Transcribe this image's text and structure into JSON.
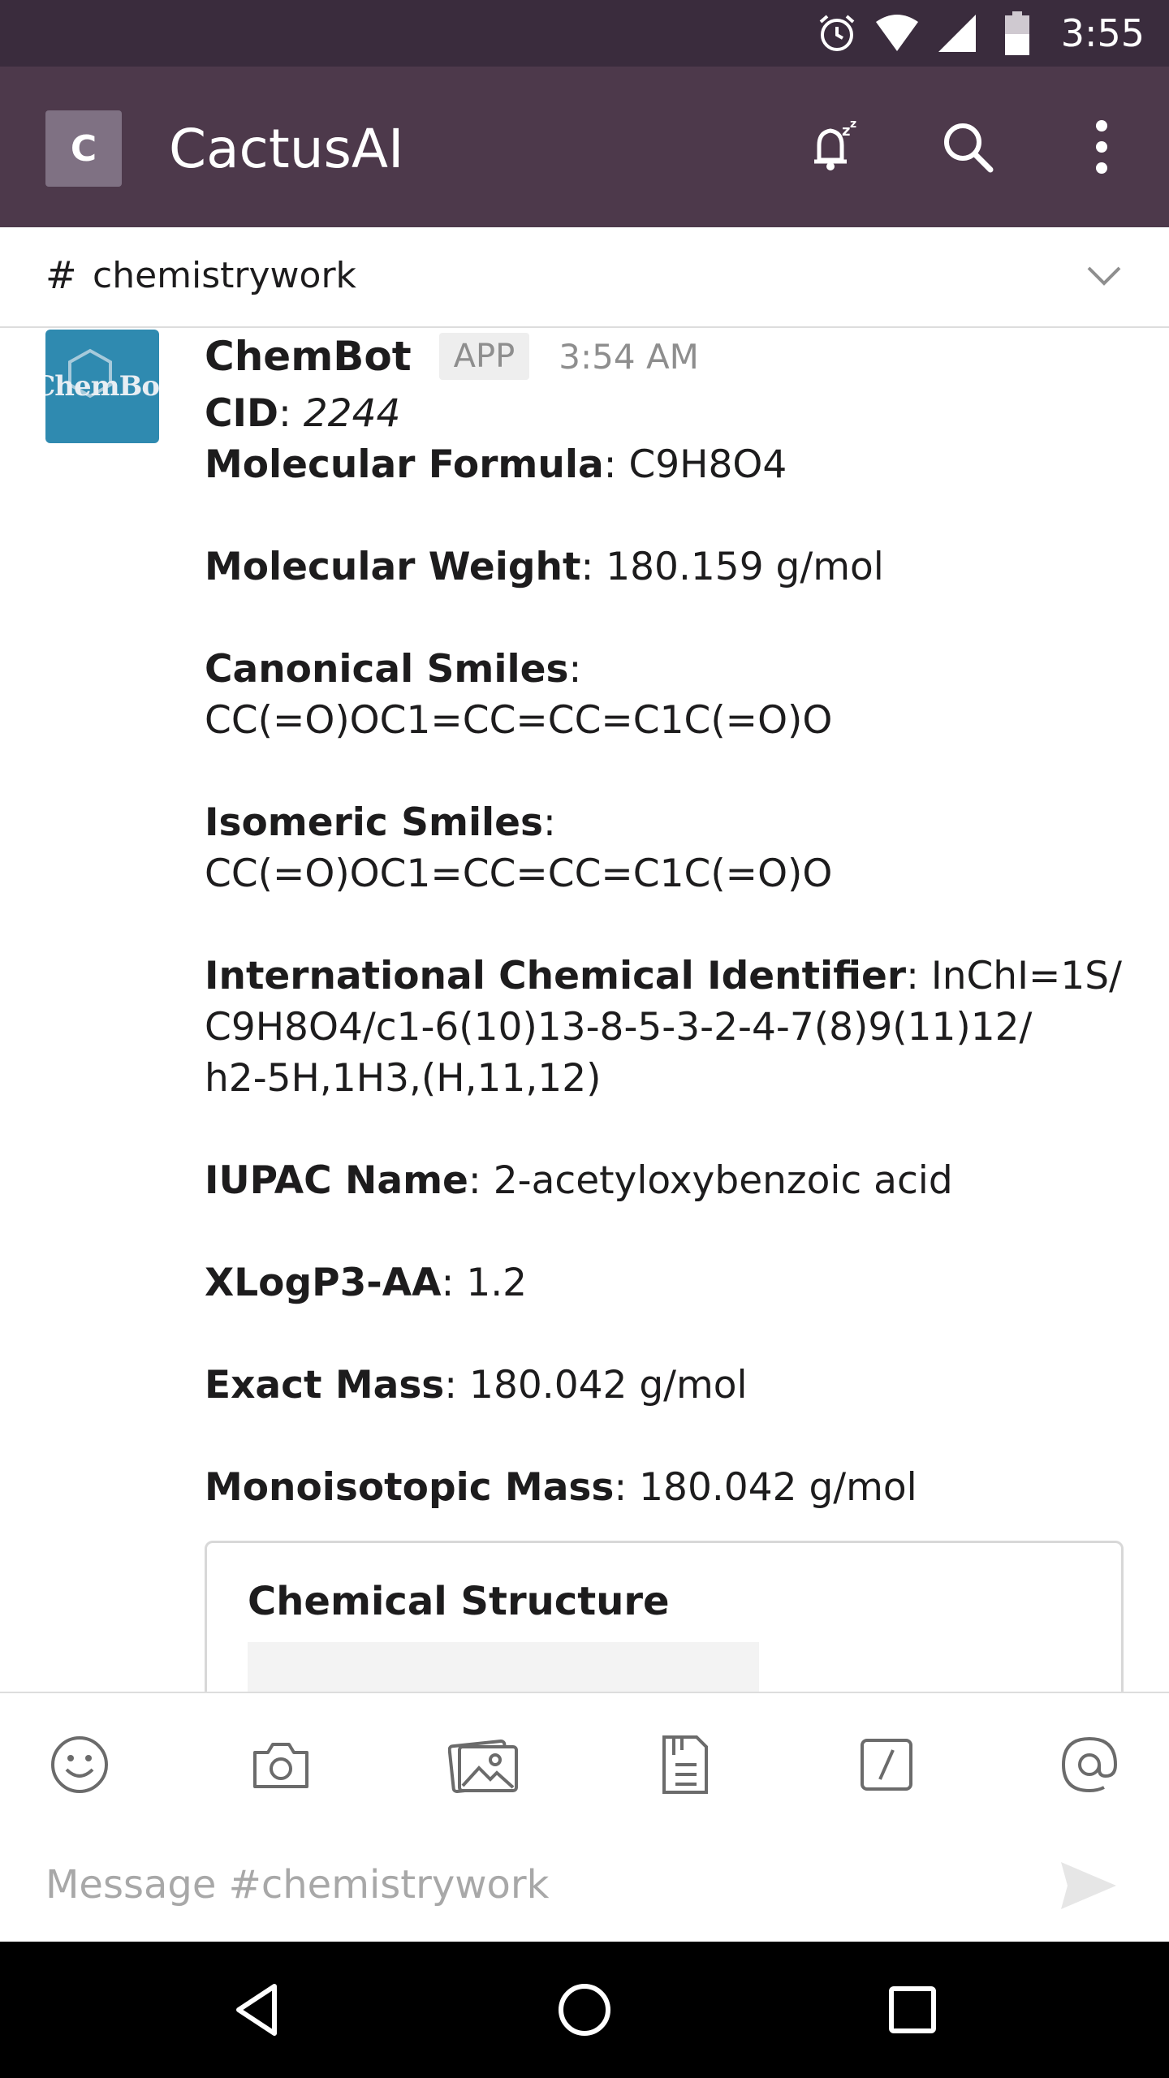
{
  "status_bar": {
    "time": "3:55",
    "icons": [
      "alarm-icon",
      "wifi-icon",
      "signal-icon",
      "battery-icon"
    ]
  },
  "app_bar": {
    "team_initial": "C",
    "team_name": "CactusAI",
    "actions": [
      "snooze-bell-icon",
      "search-icon",
      "more-vert-icon"
    ]
  },
  "channel": {
    "hash": "#",
    "name": "chemistrywork",
    "chevron": "chevron-down-icon"
  },
  "message": {
    "avatar_text": "ChemBot",
    "sender": "ChemBot",
    "badge": "APP",
    "time": "3:54 AM",
    "fields": {
      "cid_label": "CID",
      "cid_value": "2244",
      "formula_label": "Molecular Formula",
      "formula_value": "C9H8O4",
      "weight_label": "Molecular Weight",
      "weight_value": "180.159 g/mol",
      "canonical_label": "Canonical Smiles",
      "canonical_value": "CC(=O)OC1=CC=CC=C1C(=O)O",
      "isomeric_label": "Isomeric Smiles",
      "isomeric_value": "CC(=O)OC1=CC=CC=C1C(=O)O",
      "inchi_label": "International Chemical Identifier",
      "inchi_value_1": "InChI=1S/",
      "inchi_value_2": "C9H8O4/c1-6(10)13-8-5-3-2-4-7(8)9(11)12/",
      "inchi_value_3": "h2-5H,1H3,(H,11,12)",
      "iupac_label": "IUPAC Name",
      "iupac_value": "2-acetyloxybenzoic acid",
      "xlogp_label": "XLogP3-AA",
      "xlogp_value": "1.2",
      "exact_label": "Exact Mass",
      "exact_value": "180.042 g/mol",
      "mono_label": "Monoisotopic Mass",
      "mono_value": "180.042 g/mol"
    },
    "attachment_title": "Chemical Structure"
  },
  "composer": {
    "tools": [
      "emoji-icon",
      "camera-icon",
      "photo-gallery-icon",
      "file-icon",
      "slash-command-icon",
      "mention-icon"
    ],
    "placeholder": "Message #chemistrywork",
    "send": "send-icon"
  },
  "nav_bar": {
    "buttons": [
      "back-icon",
      "home-icon",
      "recents-icon"
    ]
  },
  "colors": {
    "status_bar": "#3a2c3d",
    "app_bar": "#4d394b",
    "team_avatar": "#7f7183",
    "bot_avatar": "#2f8ab0",
    "muted_text": "#8e8e8e"
  }
}
